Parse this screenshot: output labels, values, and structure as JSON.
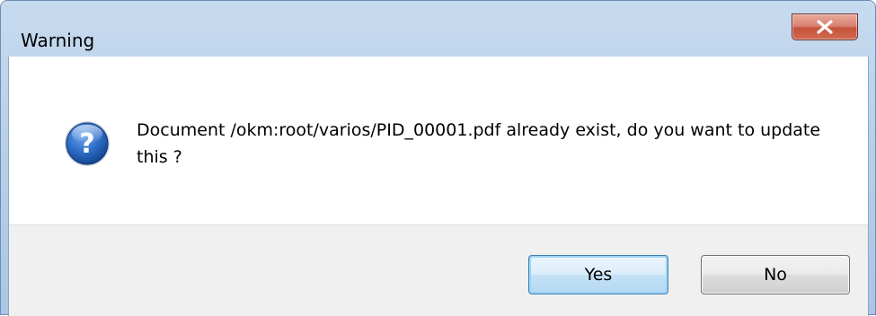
{
  "dialog": {
    "title": "Warning",
    "message": "Document /okm:root/varios/PID_00001.pdf already exist, do you want to update this ?",
    "icon": "question-icon"
  },
  "buttons": {
    "yes_label": "Yes",
    "no_label": "No"
  },
  "colors": {
    "titlebar": "#b9d1ea",
    "close_button": "#c7523c",
    "button_bar": "#f0f0f0",
    "default_button_border": "#3c7fb1",
    "icon_blue": "#1e5fb8"
  }
}
